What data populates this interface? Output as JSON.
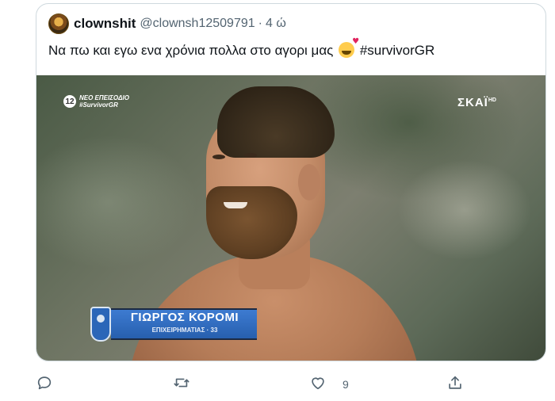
{
  "tweet": {
    "author": {
      "display_name": "clownshit",
      "handle": "@clownsh12509791"
    },
    "separator": "·",
    "time": "4 ώ",
    "text": "Να πω και εγω ενα χρόνια πολλα στο αγορι μας",
    "emoji": "smiling-face-with-hearts",
    "hashtag": "#survivorGR",
    "media": {
      "rating": "12",
      "badge_line1": "ΝΕΟ ΕΠΕΙΣΟΔΙΟ",
      "badge_line2": "#SurvivorGR",
      "channel_logo": "ΣΚΑΪ",
      "channel_logo_sup": "HD",
      "nameplate_name": "ΓΙΩΡΓΟΣ ΚΟΡΟΜΙ",
      "nameplate_subtitle": "ΕΠΙΧΕΙΡΗΜΑΤΙΑΣ · 33"
    }
  },
  "actions": {
    "like_count": "9",
    "icons": [
      "reply-icon",
      "retweet-icon",
      "like-icon",
      "share-icon"
    ]
  }
}
